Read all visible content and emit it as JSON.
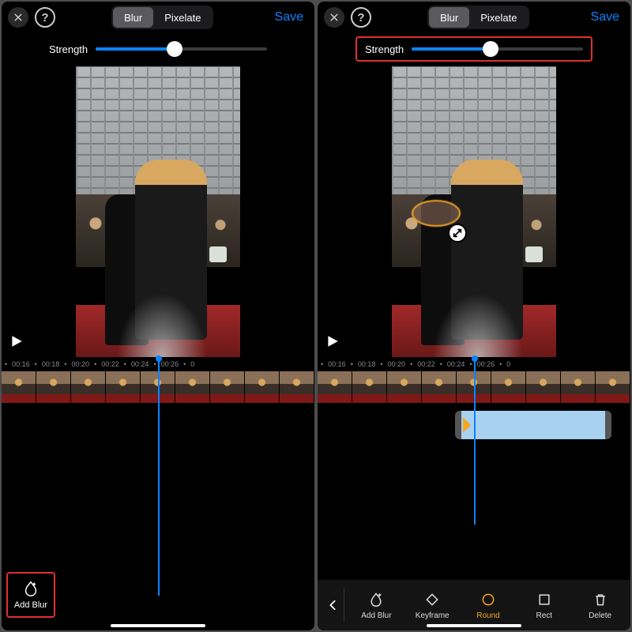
{
  "header": {
    "segment": {
      "blur": "Blur",
      "pixelate": "Pixelate"
    },
    "save": "Save"
  },
  "strength": {
    "label": "Strength",
    "value_pct": 46
  },
  "ruler": {
    "times": [
      "00:16",
      "00:18",
      "00:20",
      "00:22",
      "00:24",
      "00:26"
    ],
    "edge_left": "•",
    "edge_right": "0"
  },
  "left": {
    "add_blur": "Add Blur"
  },
  "right": {
    "toolbar": {
      "add_blur": "Add Blur",
      "keyframe": "Keyframe",
      "round": "Round",
      "rect": "Rect",
      "delete": "Delete"
    }
  }
}
